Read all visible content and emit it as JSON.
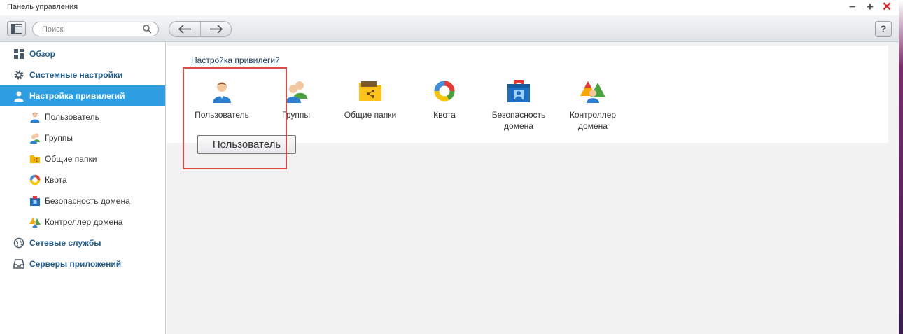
{
  "window": {
    "title": "Панель управления"
  },
  "toolbar": {
    "search_placeholder": "Поиск",
    "help_label": "?"
  },
  "sidebar": {
    "items": [
      {
        "label": "Обзор",
        "icon": "grid-icon",
        "level": "top"
      },
      {
        "label": "Системные настройки",
        "icon": "gear-icon",
        "level": "top"
      },
      {
        "label": "Настройка привилегий",
        "icon": "user-icon",
        "level": "top",
        "active": true
      },
      {
        "label": "Пользователь",
        "icon": "user-icon",
        "level": "sub"
      },
      {
        "label": "Группы",
        "icon": "users-icon",
        "level": "sub"
      },
      {
        "label": "Общие папки",
        "icon": "shared-folder-icon",
        "level": "sub"
      },
      {
        "label": "Квота",
        "icon": "quota-ring-icon",
        "level": "sub"
      },
      {
        "label": "Безопасность домена",
        "icon": "domain-security-icon",
        "level": "sub"
      },
      {
        "label": "Контроллер домена",
        "icon": "domain-controller-icon",
        "level": "sub"
      },
      {
        "label": "Сетевые службы",
        "icon": "globe-icon",
        "level": "top"
      },
      {
        "label": "Серверы приложений",
        "icon": "server-tray-icon",
        "level": "top"
      }
    ]
  },
  "main": {
    "section_title": "Настройка привилегий",
    "apps": [
      {
        "label": "Пользователь",
        "icon": "user-icon"
      },
      {
        "label": "Группы",
        "icon": "users-icon"
      },
      {
        "label": "Общие папки",
        "icon": "shared-folder-icon"
      },
      {
        "label": "Квота",
        "icon": "quota-ring-icon"
      },
      {
        "label": "Безопасность домена",
        "icon": "domain-security-icon"
      },
      {
        "label": "Контроллер домена",
        "icon": "domain-controller-icon"
      }
    ],
    "tooltip": "Пользователь"
  },
  "colors": {
    "accent": "#2e9ee3",
    "link": "#1f5f96",
    "highlight": "#dd4b48",
    "close": "#d9262a"
  }
}
